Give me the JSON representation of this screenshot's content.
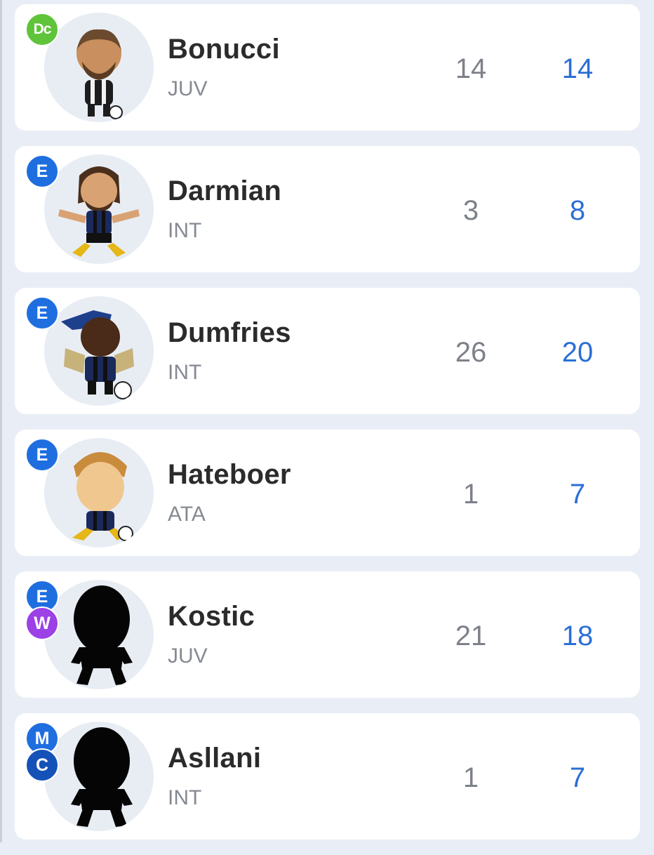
{
  "colors": {
    "badge_dc": "#5fc43a",
    "badge_e": "#1e6ee0",
    "badge_w": "#9b41e6",
    "badge_m": "#1e6ee0",
    "badge_c": "#1552b8",
    "stat_secondary": "#2b6fd6"
  },
  "players": [
    {
      "name": "Bonucci",
      "team": "JUV",
      "stat1": "14",
      "stat2": "14",
      "roles": [
        "Dc"
      ],
      "avatar": "cartoon-player-avatar"
    },
    {
      "name": "Darmian",
      "team": "INT",
      "stat1": "3",
      "stat2": "8",
      "roles": [
        "E"
      ],
      "avatar": "cartoon-player-avatar"
    },
    {
      "name": "Dumfries",
      "team": "INT",
      "stat1": "26",
      "stat2": "20",
      "roles": [
        "E"
      ],
      "avatar": "cartoon-player-avatar"
    },
    {
      "name": "Hateboer",
      "team": "ATA",
      "stat1": "1",
      "stat2": "7",
      "roles": [
        "E"
      ],
      "avatar": "cartoon-player-avatar"
    },
    {
      "name": "Kostic",
      "team": "JUV",
      "stat1": "21",
      "stat2": "18",
      "roles": [
        "E",
        "W"
      ],
      "avatar": "silhouette-avatar"
    },
    {
      "name": "Asllani",
      "team": "INT",
      "stat1": "1",
      "stat2": "7",
      "roles": [
        "M",
        "C"
      ],
      "avatar": "silhouette-avatar"
    }
  ]
}
